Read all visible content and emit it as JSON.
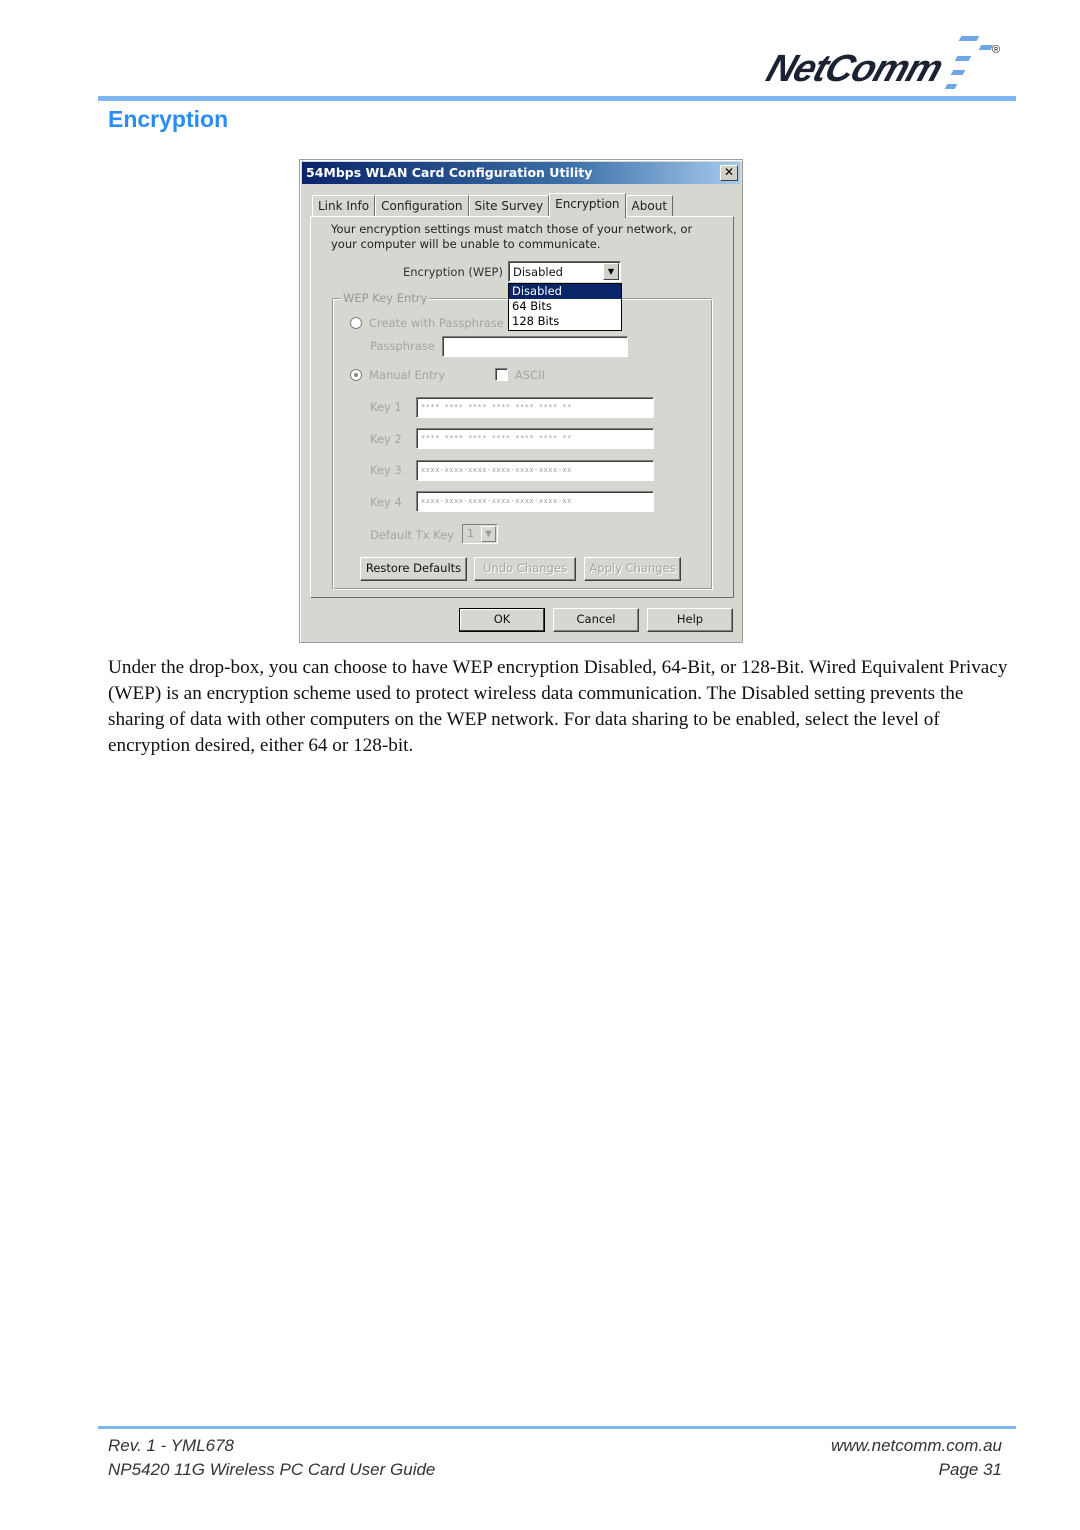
{
  "header": {
    "brand": "NetComm",
    "registered_mark": "®",
    "section_title": "Encryption"
  },
  "dialog": {
    "title": "54Mbps WLAN Card Configuration Utility",
    "close_glyph": "✕",
    "tabs": [
      {
        "label": "Link Info",
        "active": false
      },
      {
        "label": "Configuration",
        "active": false
      },
      {
        "label": "Site Survey",
        "active": false
      },
      {
        "label": "Encryption",
        "active": true
      },
      {
        "label": "About",
        "active": false
      }
    ],
    "intro_text": "Your encryption settings must match those of your network, or your computer will be unable to communicate.",
    "encryption_label": "Encryption (WEP)",
    "encryption_value": "Disabled",
    "dropdown_arrow": "▼",
    "encryption_options": [
      "Disabled",
      "64 Bits",
      "128 Bits"
    ],
    "encryption_selected_index": 0,
    "wep_group_label": "WEP Key Entry",
    "create_passphrase_label": "Create with Passphrase",
    "create_passphrase_checked": false,
    "passphrase_label": "Passphrase",
    "passphrase_value": "",
    "manual_entry_label": "Manual Entry",
    "manual_entry_checked": true,
    "ascii_label": "ASCII",
    "ascii_checked": false,
    "keys": [
      {
        "label": "Key 1",
        "value": "**** **** **** **** **** **** **"
      },
      {
        "label": "Key 2",
        "value": "**** **** **** **** **** **** **"
      },
      {
        "label": "Key 3",
        "value": "xxxx-xxxx-xxxx-xxxx-xxxx-xxxx-xx"
      },
      {
        "label": "Key 4",
        "value": "xxxx-xxxx-xxxx-xxxx-xxxx-xxxx-xx"
      }
    ],
    "default_tx_key_label": "Default Tx Key",
    "default_tx_key_value": "1",
    "buttons": {
      "restore_defaults": "Restore Defaults",
      "undo_changes": "Undo Changes",
      "apply_changes": "Apply Changes",
      "ok": "OK",
      "cancel": "Cancel",
      "help": "Help"
    }
  },
  "body": {
    "paragraph": "Under the drop-box, you can choose to have WEP encryption Disabled, 64-Bit, or 128-Bit. Wired Equivalent Privacy (WEP) is an encryption scheme used to protect wireless data communication.  The Disabled setting prevents the sharing of data with other computers on the WEP network. For data sharing to be enabled, select the level of encryption desired, either 64 or 128-bit."
  },
  "footer": {
    "revision": "Rev. 1 - YML678",
    "website": "www.netcomm.com.au",
    "guide_title": "NP5420 11G Wireless PC Card User Guide",
    "page": "Page 31"
  },
  "colors": {
    "accent_blue": "#2a8cf5",
    "rule_blue": "#7db6f2",
    "titlebar_blue": "#0a246a"
  }
}
